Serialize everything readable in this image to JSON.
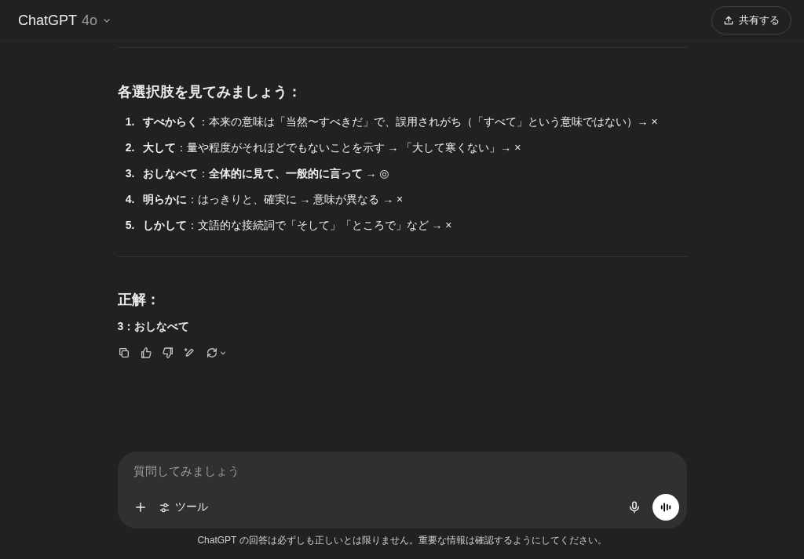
{
  "header": {
    "model_name": "ChatGPT",
    "model_version": "4o",
    "share_button": "共有する"
  },
  "message": {
    "heading": "各選択肢を見てみましょう：",
    "items": [
      {
        "number": "1.",
        "text": "**すべからく**：本来の意味は「当然〜すべきだ」で、誤用されがち（「すべて」という意味ではない）→ ×"
      },
      {
        "number": "2.",
        "text": "**大して**：量や程度がそれほどでもないことを示す → 「大して寒くない」→ ×"
      },
      {
        "number": "3.",
        "text": "**おしなべて**：**全体的に見て、一般的に言って** → ◎"
      },
      {
        "number": "4.",
        "text": "**明らかに**：はっきりと、確実に → 意味が異なる → ×"
      },
      {
        "number": "5.",
        "text": "**しかして**：文語的な接続詞で「そして」「ところで」など → ×"
      }
    ],
    "answer_heading": "正解：",
    "answer": "3：おしなべて"
  },
  "composer": {
    "placeholder": "質問してみましょう",
    "tools_button": "ツール"
  },
  "disclaimer": "ChatGPT の回答は必ずしも正しいとは限りません。重要な情報は確認するようにしてください。"
}
